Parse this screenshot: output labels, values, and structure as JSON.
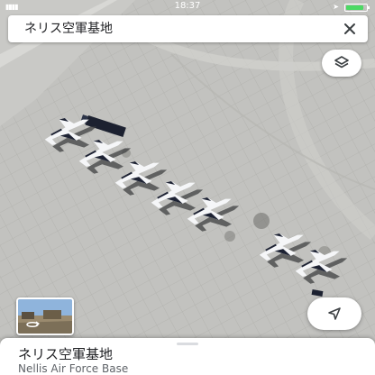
{
  "status_bar": {
    "time": "18:37",
    "signal_icon": "signal-bars-icon",
    "battery_level": 0.85,
    "battery_color": "#4cd964"
  },
  "search": {
    "query": "ネリス空軍基地",
    "clear_icon": "close-icon"
  },
  "map": {
    "view": "satellite",
    "layers_icon": "layers-icon",
    "location_icon": "navigation-arrow-icon",
    "street_view_icon": "street-view-rotate-icon"
  },
  "place": {
    "name": "ネリス空軍基地",
    "subtitle": "Nellis Air Force Base"
  }
}
